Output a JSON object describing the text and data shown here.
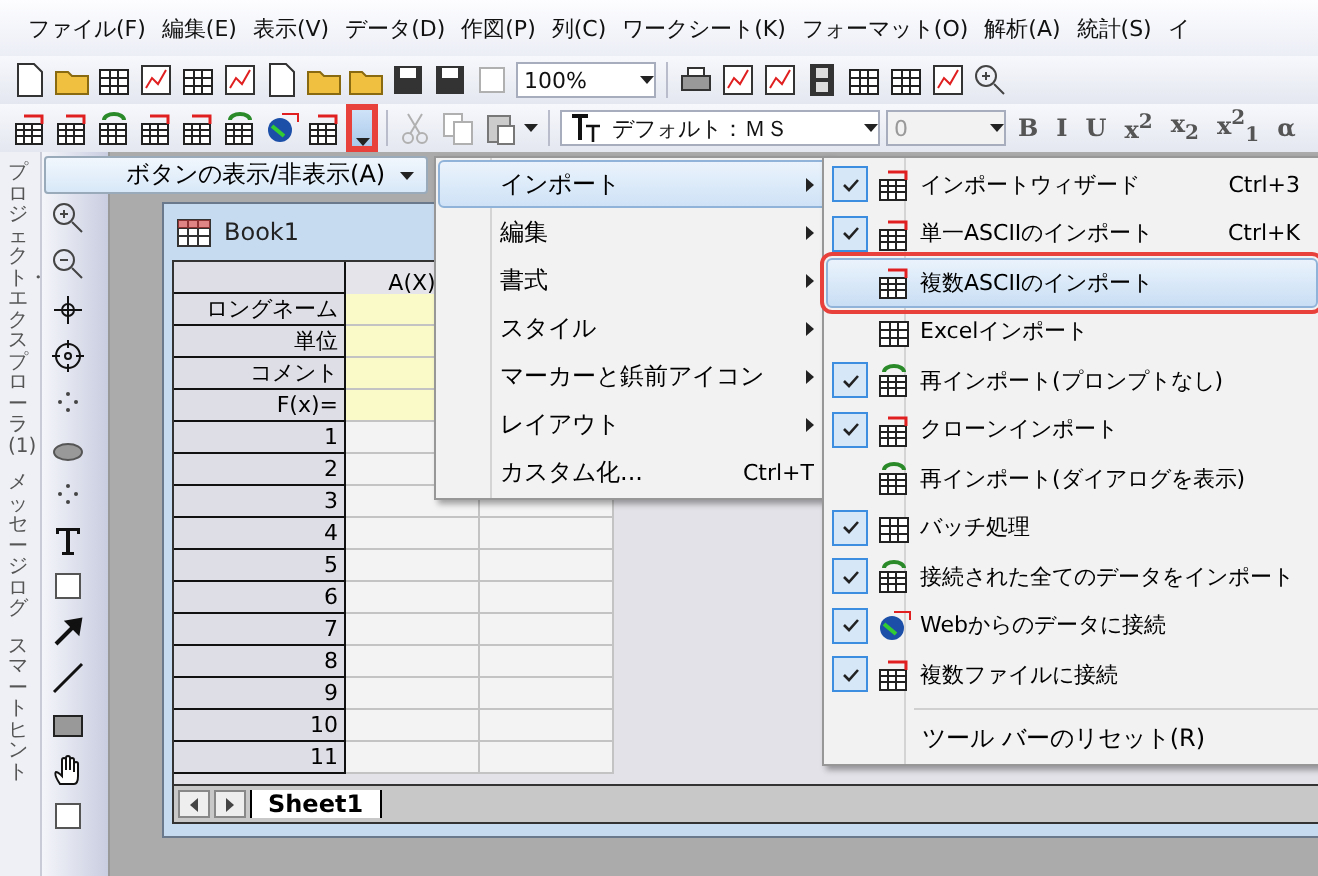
{
  "menu_bar": {
    "items": [
      "ファイル(F)",
      "編集(E)",
      "表示(V)",
      "データ(D)",
      "作図(P)",
      "列(C)",
      "ワークシート(K)",
      "フォーマット(O)",
      "解析(A)",
      "統計(S)",
      "イ"
    ]
  },
  "toolbar_standard": {
    "zoom": "100%"
  },
  "toolbar_import": {
    "more_button": {
      "annotated": true
    },
    "font": "デフォルト：ＭＳ",
    "font_size": "0",
    "format_buttons": [
      "B",
      "I",
      "U",
      "x$^{2}$",
      "x$_{2}$",
      "x$^{2}$$_{1}$",
      "α"
    ]
  },
  "side_tabs": [
    "プロジェクト・エクスプローラ(1)",
    "メッセージログ",
    "スマートヒント"
  ],
  "book": {
    "title": "Book1",
    "columns": [
      "A(X)"
    ],
    "header_rows": [
      "ロングネーム",
      "単位",
      "コメント",
      "F(x)="
    ],
    "rows": [
      "1",
      "2",
      "3",
      "4",
      "5",
      "6",
      "7",
      "8",
      "9",
      "10",
      "11"
    ],
    "sheet_tab": "Sheet1"
  },
  "popup": {
    "label": "ボタンの表示/非表示(A)",
    "submenu": [
      {
        "label": "インポート",
        "has_submenu": true,
        "selected": true
      },
      {
        "label": "編集",
        "has_submenu": true,
        "selected": false
      },
      {
        "label": "書式",
        "has_submenu": true,
        "selected": false
      },
      {
        "label": "スタイル",
        "has_submenu": true,
        "selected": false
      },
      {
        "label": "マーカーと鋲前アイコン",
        "has_submenu": true,
        "selected": false
      },
      {
        "label": "レイアウト",
        "has_submenu": true,
        "selected": false
      },
      {
        "label": "カスタム化...",
        "shortcut": "Ctrl+T",
        "has_submenu": false,
        "selected": false
      }
    ],
    "import_items": [
      {
        "label": "インポートウィザード",
        "shortcut": "Ctrl+3",
        "checked": true,
        "selected": false,
        "annotated": false
      },
      {
        "label": "単一ASCIIのインポート",
        "shortcut": "Ctrl+K",
        "checked": true,
        "selected": false,
        "annotated": false
      },
      {
        "label": "複数ASCIIのインポート",
        "checked": false,
        "selected": true,
        "annotated": true
      },
      {
        "label": "Excelインポート",
        "checked": false,
        "selected": false,
        "annotated": false
      },
      {
        "label": "再インポート(プロンプトなし)",
        "checked": true,
        "selected": false,
        "annotated": false
      },
      {
        "label": "クローンインポート",
        "checked": true,
        "selected": false,
        "annotated": false
      },
      {
        "label": "再インポート(ダイアログを表示)",
        "checked": false,
        "selected": false,
        "annotated": false
      },
      {
        "label": "バッチ処理",
        "checked": true,
        "selected": false,
        "annotated": false
      },
      {
        "label": "接続された全てのデータをインポート",
        "checked": true,
        "selected": false,
        "annotated": false
      },
      {
        "label": "Webからのデータに接続",
        "checked": true,
        "selected": false,
        "annotated": false
      },
      {
        "label": "複数ファイルに接続",
        "checked": true,
        "selected": false,
        "annotated": false
      }
    ],
    "reset": "ツール バーのリセット(R)"
  }
}
